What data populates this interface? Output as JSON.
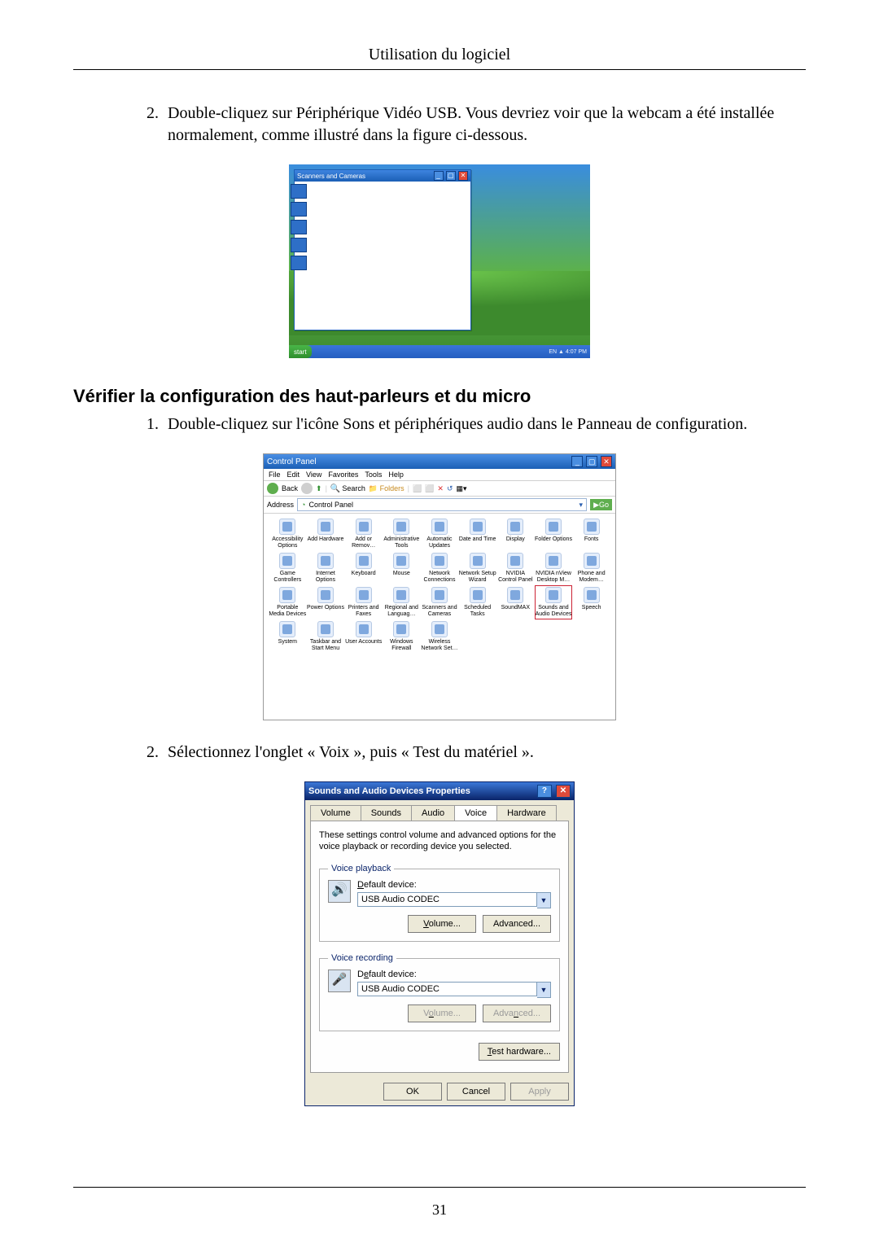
{
  "running_head": "Utilisation du logiciel",
  "page_number": "31",
  "item2_text": "Double-cliquez sur Périphérique Vidéo USB. Vous devriez voir que la webcam a été installée normalement, comme illustré dans la figure ci-dessous.",
  "section_heading": "Vérifier la configuration des haut-parleurs et du micro",
  "step1_text": "Double-cliquez sur l'icône Sons et périphériques audio dans le Panneau de configuration.",
  "step2_text": "Sélectionnez l'onglet « Voix », puis « Test du matériel ».",
  "shot1": {
    "start": "start",
    "tray": "EN  ▲  4:07 PM"
  },
  "shot2": {
    "title": "Control Panel",
    "menus": [
      "File",
      "Edit",
      "View",
      "Favorites",
      "Tools",
      "Help"
    ],
    "back": "Back",
    "search": "Search",
    "folders": "Folders",
    "address_label": "Address",
    "address_value": "Control Panel",
    "go": "Go",
    "icons": [
      "Accessibility Options",
      "Add Hardware",
      "Add or Remov…",
      "Administrative Tools",
      "Automatic Updates",
      "Date and Time",
      "Display",
      "Folder Options",
      "Fonts",
      "Game Controllers",
      "Internet Options",
      "Keyboard",
      "Mouse",
      "Network Connections",
      "Network Setup Wizard",
      "NVIDIA Control Panel",
      "NVIDIA nView Desktop M…",
      "Phone and Modem…",
      "Portable Media Devices",
      "Power Options",
      "Printers and Faxes",
      "Regional and Languag…",
      "Scanners and Cameras",
      "Scheduled Tasks",
      "SoundMAX",
      "Sounds and Audio Devices",
      "Speech",
      "System",
      "Taskbar and Start Menu",
      "User Accounts",
      "Windows Firewall",
      "Wireless Network Set…"
    ],
    "highlight_index": 25
  },
  "shot3": {
    "title": "Sounds and Audio Devices Properties",
    "help": "?",
    "close": "✕",
    "tabs": [
      "Volume",
      "Sounds",
      "Audio",
      "Voice",
      "Hardware"
    ],
    "active_tab": 3,
    "description": "These settings control volume and advanced options for the voice playback or recording device you selected.",
    "playback": {
      "legend": "Voice playback",
      "label": "Default device:",
      "label_underline": "D",
      "device": "USB Audio CODEC",
      "volume": "Volume...",
      "volume_u": "V",
      "advanced": "Advanced...",
      "advanced_u": ""
    },
    "recording": {
      "legend": "Voice recording",
      "label": "Default device:",
      "label_underline": "e",
      "device": "USB Audio CODEC",
      "volume": "Volume...",
      "volume_u": "o",
      "advanced": "Advanced...",
      "advanced_u": "n"
    },
    "test_hw": "Test hardware...",
    "test_hw_u": "T",
    "ok": "OK",
    "cancel": "Cancel",
    "apply": "Apply"
  }
}
